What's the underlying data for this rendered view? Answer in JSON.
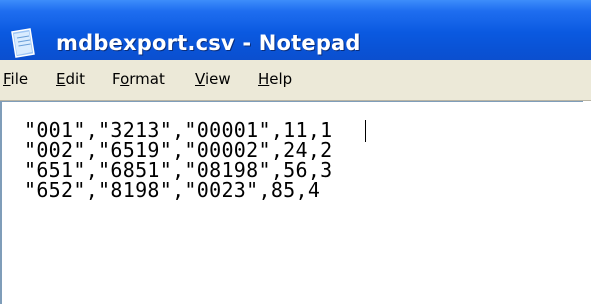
{
  "window": {
    "title": "mdbexport.csv - Notepad",
    "app_icon": "notepad-icon"
  },
  "menu": {
    "items": [
      {
        "label": "File",
        "mnemonic_index": 0
      },
      {
        "label": "Edit",
        "mnemonic_index": 0
      },
      {
        "label": "Format",
        "mnemonic_index": 1
      },
      {
        "label": "View",
        "mnemonic_index": 0
      },
      {
        "label": "Help",
        "mnemonic_index": 0
      }
    ]
  },
  "editor": {
    "lines": [
      "\"001\",\"3213\",\"00001\",11,1",
      "\"002\",\"6519\",\"00002\",24,2",
      "\"651\",\"6851\",\"08198\",56,3",
      "\"652\",\"8198\",\"0023\",85,4"
    ]
  },
  "colors": {
    "titlebar": "#0a59e0",
    "menubar": "#ece9d8",
    "editor_background": "#ffffff"
  }
}
